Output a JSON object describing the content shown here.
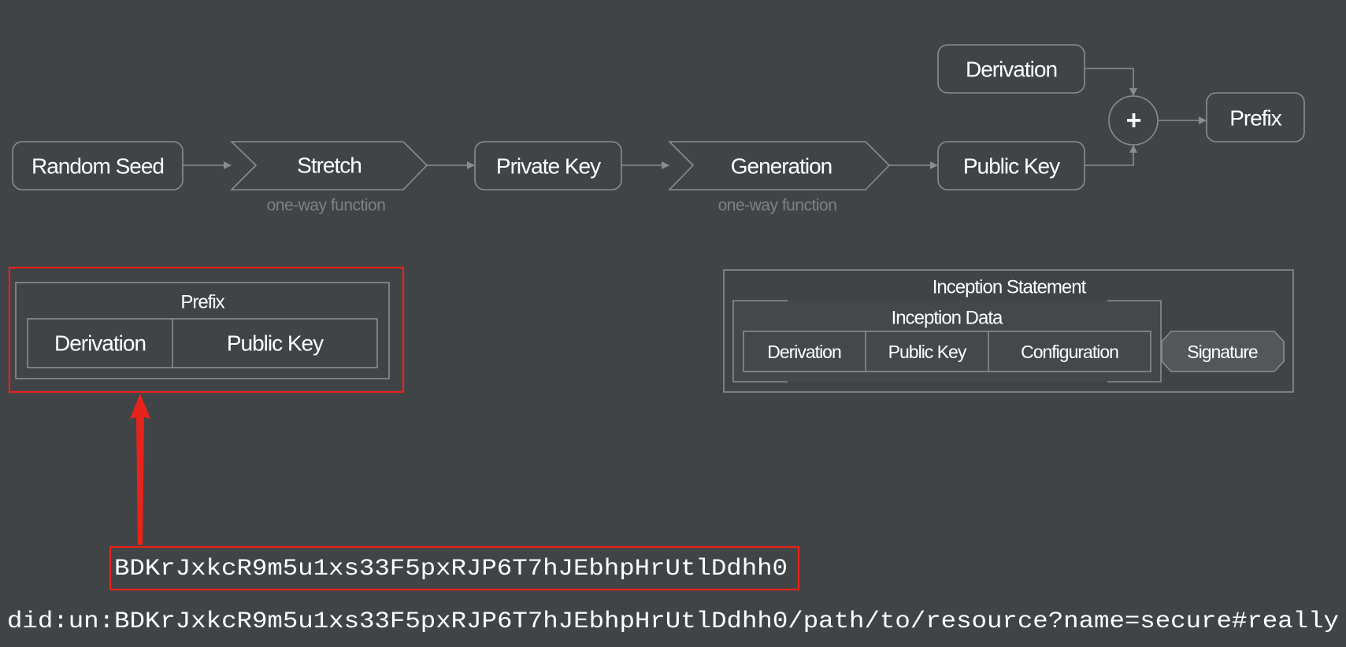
{
  "flow": {
    "random_seed": "Random Seed",
    "stretch": "Stretch",
    "stretch_sub": "one-way function",
    "private_key": "Private Key",
    "generation": "Generation",
    "generation_sub": "one-way function",
    "public_key": "Public Key",
    "derivation": "Derivation",
    "plus": "+",
    "prefix": "Prefix"
  },
  "prefix_block": {
    "title": "Prefix",
    "cells": [
      "Derivation",
      "Public Key"
    ]
  },
  "inception": {
    "title": "Inception Statement",
    "data_title": "Inception Data",
    "cells": [
      "Derivation",
      "Public Key",
      "Configuration"
    ],
    "signature": "Signature"
  },
  "identifier": "BDKrJxkcR9m5u1xs33F5pxRJP6T7hJEbhpHrUtlDdhh0",
  "did": "did:un:BDKrJxkcR9m5u1xs33F5pxRJP6T7hJEbhpHrUtlDdhh0/path/to/resource?name=secure#really",
  "colors": {
    "background": "#414447",
    "highlight": "#e8231b",
    "stroke": "#8a8d90"
  }
}
